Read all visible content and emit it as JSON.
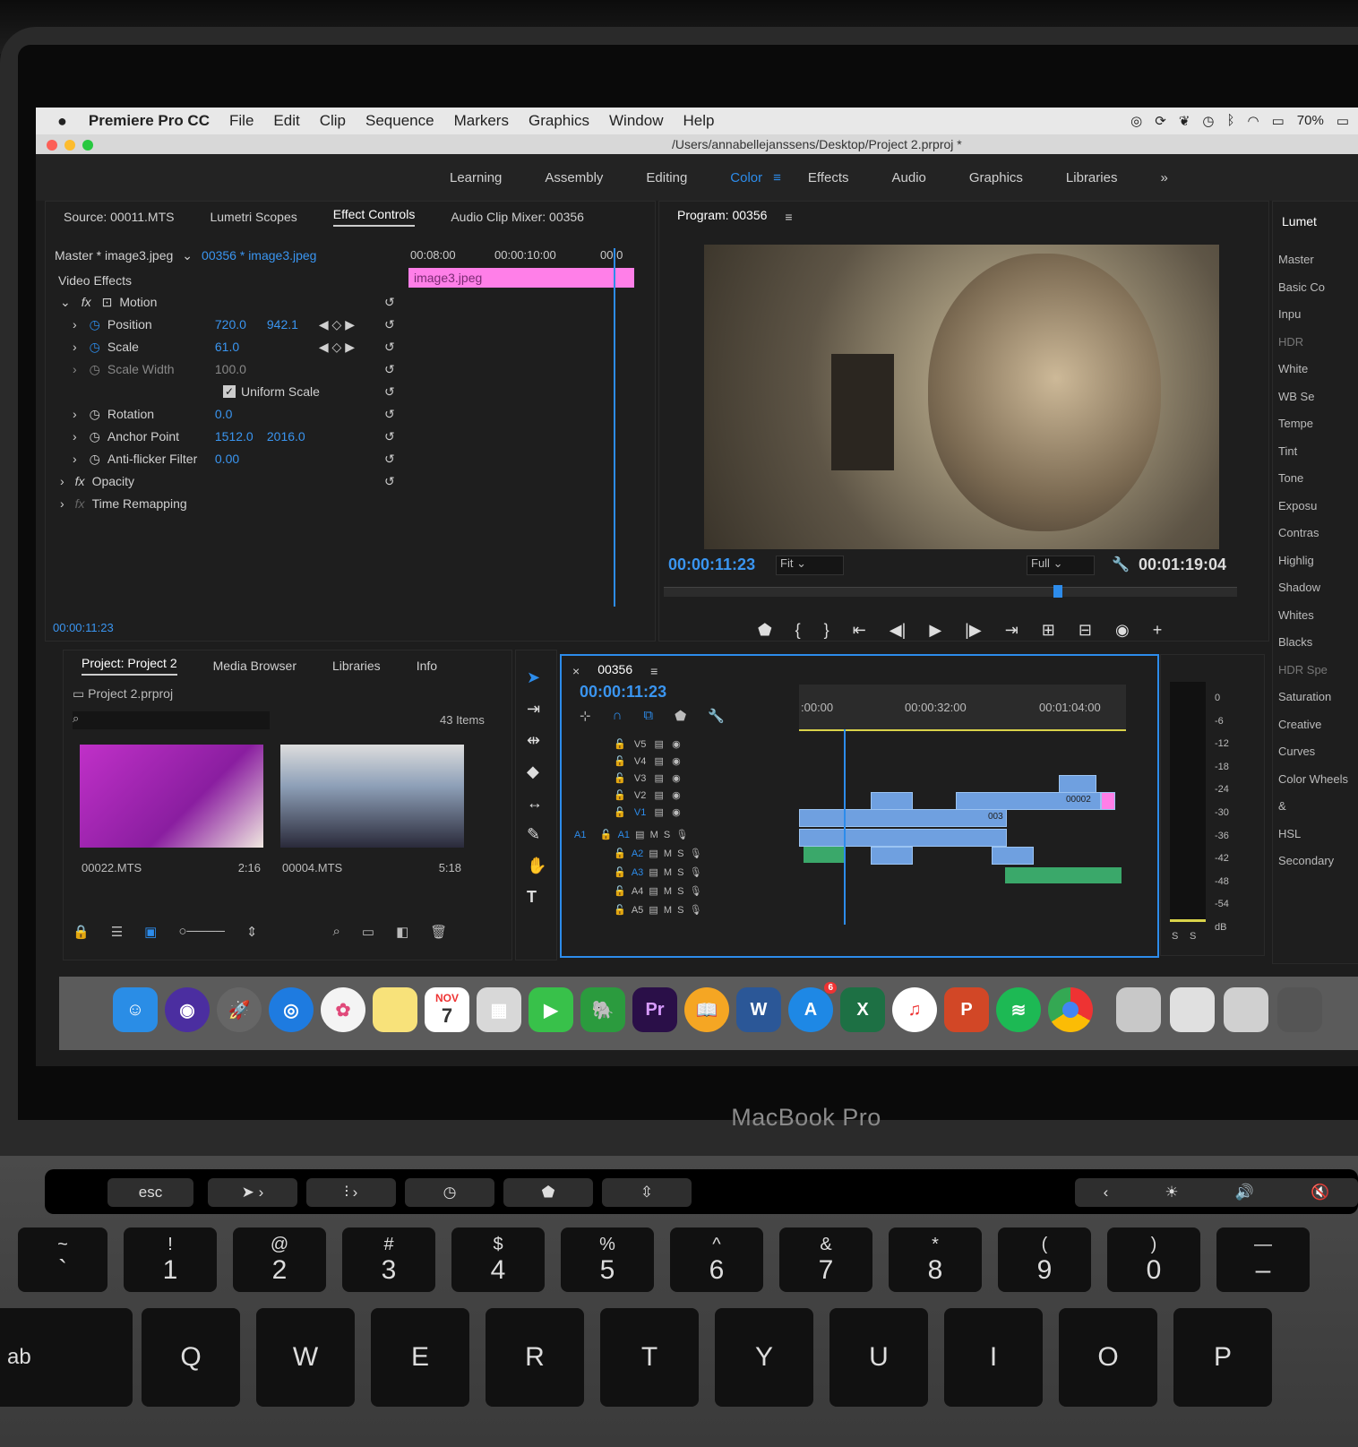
{
  "menubar": {
    "app_name": "Premiere Pro CC",
    "items": [
      "File",
      "Edit",
      "Clip",
      "Sequence",
      "Markers",
      "Graphics",
      "Window",
      "Help"
    ],
    "battery": "70%"
  },
  "titlebar": {
    "path": "/Users/annabellejanssens/Desktop/Project 2.prproj *"
  },
  "workspaces": [
    "Learning",
    "Assembly",
    "Editing",
    "Color",
    "Effects",
    "Audio",
    "Graphics",
    "Libraries",
    "»"
  ],
  "active_workspace": "Color",
  "source_panel": {
    "tabs": [
      "Source: 00011.MTS",
      "Lumetri Scopes",
      "Effect Controls",
      "Audio Clip Mixer: 00356"
    ],
    "master_label": "Master * image3.jpeg",
    "sequence_label": "00356 * image3.jpeg",
    "timecodes": [
      "00:08:00",
      "00:00:10:00",
      "00:0"
    ],
    "clip_name": "image3.jpeg",
    "video_effects": "Video Effects",
    "motion": "Motion",
    "rows": [
      {
        "label": "Position",
        "v1": "720.0",
        "v2": "942.1"
      },
      {
        "label": "Scale",
        "v1": "61.0",
        "v2": ""
      },
      {
        "label": "Scale Width",
        "v1": "100.0",
        "v2": ""
      },
      {
        "label": "Uniform Scale",
        "v1": "",
        "v2": ""
      },
      {
        "label": "Rotation",
        "v1": "0.0",
        "v2": ""
      },
      {
        "label": "Anchor Point",
        "v1": "1512.0",
        "v2": "2016.0"
      },
      {
        "label": "Anti-flicker Filter",
        "v1": "0.00",
        "v2": ""
      }
    ],
    "opacity": "Opacity",
    "time_remapping": "Time Remapping",
    "current_time": "00:00:11:23"
  },
  "program_panel": {
    "title": "Program: 00356",
    "timecode": "00:00:11:23",
    "fit": "Fit",
    "quality": "Full",
    "duration": "00:01:19:04"
  },
  "lumetri": {
    "title": "Lumet",
    "items": [
      "Master",
      "Basic Co",
      "Inpu",
      "HDR",
      "White",
      "WB Se",
      "Tempe",
      "Tint",
      "Tone",
      "Exposu",
      "Contras",
      "Highlig",
      "Shadow",
      "Whites",
      "Blacks",
      "HDR Spe",
      "Saturation",
      "Creative",
      "Curves",
      "Color Wheels &",
      "HSL Secondary"
    ]
  },
  "project_panel": {
    "tabs": [
      "Project: Project 2",
      "Media Browser",
      "Libraries",
      "Info"
    ],
    "file": "Project 2.prproj",
    "count": "43 Items",
    "clips": [
      {
        "name": "00022.MTS",
        "duration": "2:16"
      },
      {
        "name": "00004.MTS",
        "duration": "5:18"
      }
    ]
  },
  "timeline": {
    "sequence": "00356",
    "timecode": "00:00:11:23",
    "ruler": [
      ":00:00",
      "00:00:32:00",
      "00:01:04:00"
    ],
    "video_tracks": [
      "V5",
      "V4",
      "V3",
      "V2",
      "V1"
    ],
    "audio_tracks": [
      "A1",
      "A2",
      "A3",
      "A4",
      "A5"
    ],
    "source_patch": "A1",
    "clip_labels": [
      "00002",
      "003"
    ]
  },
  "meter": {
    "scale": [
      "0",
      "-6",
      "-12",
      "-18",
      "-24",
      "-30",
      "-36",
      "-42",
      "-48",
      "-54",
      "dB"
    ],
    "solo": [
      "S",
      "S"
    ]
  },
  "dock_apps": [
    "Finder",
    "Siri",
    "Launchpad",
    "Safari",
    "Photos",
    "Notes",
    "Calendar",
    "Preview",
    "FaceTime",
    "Evernote",
    "Pr",
    "Books",
    "W",
    "App Store",
    "X",
    "iTunes",
    "P",
    "Spotify",
    "Chrome"
  ],
  "calendar": {
    "month": "NOV",
    "day": "7"
  },
  "app_store_badge": "6",
  "laptop": {
    "brand": "MacBook Pro"
  },
  "touchbar": {
    "esc": "esc"
  },
  "keys_number": [
    {
      "top": "~",
      "bottom": "`"
    },
    {
      "top": "!",
      "bottom": "1"
    },
    {
      "top": "@",
      "bottom": "2"
    },
    {
      "top": "#",
      "bottom": "3"
    },
    {
      "top": "$",
      "bottom": "4"
    },
    {
      "top": "%",
      "bottom": "5"
    },
    {
      "top": "^",
      "bottom": "6"
    },
    {
      "top": "&",
      "bottom": "7"
    },
    {
      "top": "*",
      "bottom": "8"
    },
    {
      "top": "(",
      "bottom": "9"
    },
    {
      "top": ")",
      "bottom": "0"
    },
    {
      "top": "—",
      "bottom": "–"
    }
  ],
  "keys_letters": [
    "Q",
    "W",
    "E",
    "R",
    "T",
    "Y",
    "U",
    "I",
    "O",
    "P"
  ],
  "tab_key_partial": "ab",
  "colors": {
    "accent": "#2d8ceb",
    "clip_pink": "#ff7fe8",
    "video_clip": "#6fa0e0",
    "audio_clip": "#3aa86a"
  }
}
